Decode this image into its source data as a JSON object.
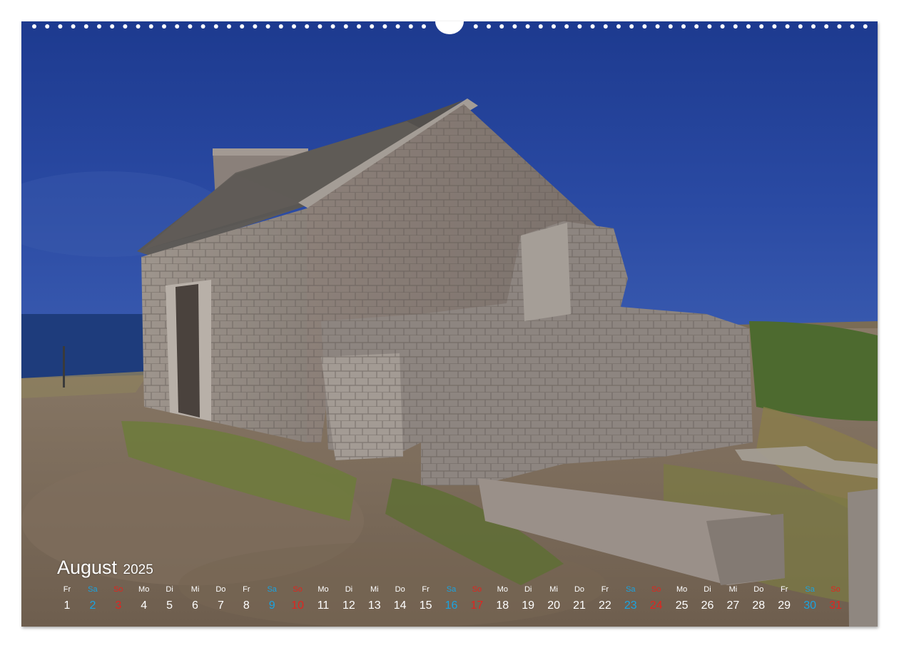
{
  "calendar": {
    "month": "August",
    "year": "2025",
    "colors": {
      "weekday": "#ffffff",
      "saturday": "#1aa3e0",
      "sunday": "#e0251f"
    },
    "days": [
      {
        "abbr": "Fr",
        "num": "1",
        "type": "weekday"
      },
      {
        "abbr": "Sa",
        "num": "2",
        "type": "saturday"
      },
      {
        "abbr": "So",
        "num": "3",
        "type": "sunday"
      },
      {
        "abbr": "Mo",
        "num": "4",
        "type": "weekday"
      },
      {
        "abbr": "Di",
        "num": "5",
        "type": "weekday"
      },
      {
        "abbr": "Mi",
        "num": "6",
        "type": "weekday"
      },
      {
        "abbr": "Do",
        "num": "7",
        "type": "weekday"
      },
      {
        "abbr": "Fr",
        "num": "8",
        "type": "weekday"
      },
      {
        "abbr": "Sa",
        "num": "9",
        "type": "saturday"
      },
      {
        "abbr": "So",
        "num": "10",
        "type": "sunday"
      },
      {
        "abbr": "Mo",
        "num": "11",
        "type": "weekday"
      },
      {
        "abbr": "Di",
        "num": "12",
        "type": "weekday"
      },
      {
        "abbr": "Mi",
        "num": "13",
        "type": "weekday"
      },
      {
        "abbr": "Do",
        "num": "14",
        "type": "weekday"
      },
      {
        "abbr": "Fr",
        "num": "15",
        "type": "weekday"
      },
      {
        "abbr": "Sa",
        "num": "16",
        "type": "saturday"
      },
      {
        "abbr": "So",
        "num": "17",
        "type": "sunday"
      },
      {
        "abbr": "Mo",
        "num": "18",
        "type": "weekday"
      },
      {
        "abbr": "Di",
        "num": "19",
        "type": "weekday"
      },
      {
        "abbr": "Mi",
        "num": "20",
        "type": "weekday"
      },
      {
        "abbr": "Do",
        "num": "21",
        "type": "weekday"
      },
      {
        "abbr": "Fr",
        "num": "22",
        "type": "weekday"
      },
      {
        "abbr": "Sa",
        "num": "23",
        "type": "saturday"
      },
      {
        "abbr": "So",
        "num": "24",
        "type": "sunday"
      },
      {
        "abbr": "Mo",
        "num": "25",
        "type": "weekday"
      },
      {
        "abbr": "Di",
        "num": "26",
        "type": "weekday"
      },
      {
        "abbr": "Mi",
        "num": "27",
        "type": "weekday"
      },
      {
        "abbr": "Do",
        "num": "28",
        "type": "weekday"
      },
      {
        "abbr": "Fr",
        "num": "29",
        "type": "weekday"
      },
      {
        "abbr": "Sa",
        "num": "30",
        "type": "saturday"
      },
      {
        "abbr": "So",
        "num": "31",
        "type": "sunday"
      }
    ]
  },
  "photo": {
    "colors": {
      "sky": "#233f95",
      "sea": "#1f3d7a",
      "stone": "#8f8680",
      "ground": "#7d6d5d",
      "grass": "#6b7a3a"
    }
  }
}
